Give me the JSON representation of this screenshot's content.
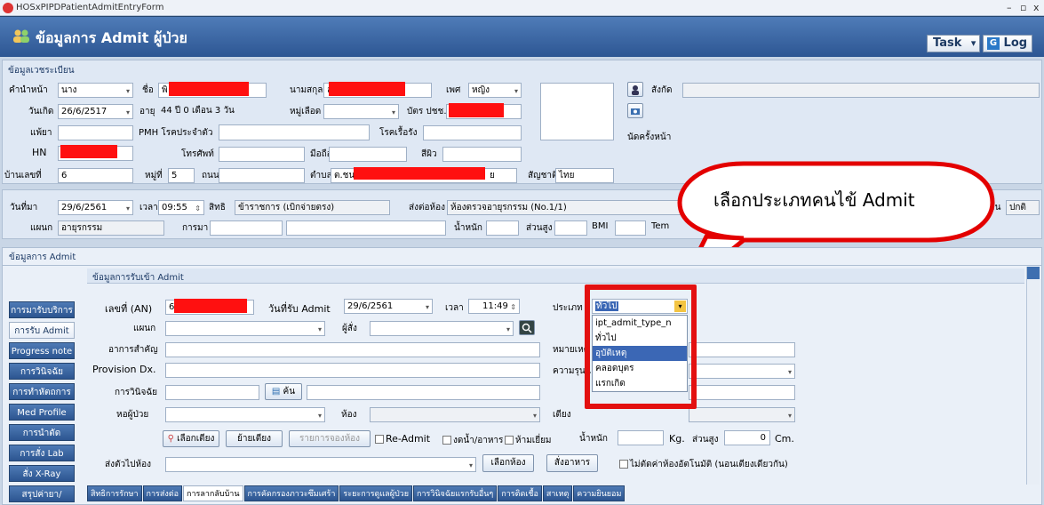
{
  "window": {
    "title": "HOSxPIPDPatientAdmitEntryForm",
    "min": "–",
    "max": "▫",
    "close": "x"
  },
  "header": {
    "title": "ข้อมูลการ Admit ผู้ป่วย",
    "task": "Task",
    "task_arrow": "▾",
    "log": "Log"
  },
  "registration": {
    "section": "ข้อมูลเวชระเบียน",
    "prefix_label": "คำนำหน้า",
    "prefix": "นาง",
    "name_label": "ชื่อ",
    "name": "พิ",
    "surname_label": "นามสกุล",
    "surname": "ล",
    "sex_label": "เพศ",
    "sex": "หญิง",
    "affiliation_label": "สังกัด",
    "dob_label": "วันเกิด",
    "dob": "26/6/2517",
    "age_label": "อายุ",
    "age": "44 ปี 0 เดือน 3 วัน",
    "blood_label": "หมู่เลือด",
    "cid_label": "บัตร ปชช.",
    "cid": "3",
    "allergy_label": "แพ้ยา",
    "pmh_label": "PMH โรคประจำตัว",
    "chronic_label": "โรคเรื้อรัง",
    "hn_label": "HN",
    "phone_label": "โทรศัพท์",
    "mobile_label": "มือถือ",
    "skin_label": "สีผิว",
    "prev_label": "นัดครั้งหน้า",
    "house_label": "บ้านเลขที่",
    "house": "6",
    "moo_label": "หมู่ที่",
    "moo": "5",
    "road_label": "ถนน",
    "tambon_label": "ตำบล",
    "tambon": "ต.ชน",
    "tambon_tail": "ย",
    "nation_label": "สัญชาติ",
    "nation": "ไทย"
  },
  "visit": {
    "date_label": "วันที่มา",
    "date": "29/6/2561",
    "time_label": "เวลา",
    "time": "09:55",
    "right_label": "สิทธิ",
    "right": "ข้าราชการ (เบิกจ่ายตรง)",
    "sendto_label": "ส่งต่อห้อง",
    "sendto": "ห้องตรวจอายุรกรรม (No.1/1)",
    "status_tail": "าน",
    "status": "ปกติ",
    "dept_label": "แผนก",
    "dept": "อายุรกรรม",
    "come_label": "การมา",
    "weight_label": "น้ำหนัก",
    "height_label": "ส่วนสูง",
    "bmi_label": "BMI",
    "temp_label": "Tem"
  },
  "callout": {
    "text": "เลือกประเภทคนไข้ Admit"
  },
  "admit": {
    "section": "ข้อมูลการ Admit",
    "subsection": "ข้อมูลการรับเข้า Admit",
    "an_label": "เลขที่ (AN)",
    "an": "6",
    "admit_date_label": "วันที่รับ Admit",
    "admit_date": "29/6/2561",
    "time_label": "เวลา",
    "time": "11:49",
    "type_label": "ประเภท",
    "type_value": "ทั่วไป",
    "type_options": [
      "ipt_admit_type_n",
      "ทั่วไป",
      "อุบัติเหตุ",
      "คลอดบุตร",
      "แรกเกิด"
    ],
    "ward_label": "แผนก",
    "orderer_label": "ผู้สั่ง",
    "symptom_label": "อาการสำคัญ",
    "note_label": "หมายเหต",
    "provdx_label": "Provision Dx.",
    "severity_label": "ความรุนแ",
    "dx_label": "การวินิจฉัย",
    "search_btn": "ค้น",
    "wardroom_label": "หอผู้ป่วย",
    "room_label": "ห้อง",
    "bed_label": "เตียง",
    "choose_bed": "เลือกเตียง",
    "move_bed": "ย้ายเตียง",
    "reserve_list": "รายการจองห้อง",
    "readmit": "Re-Admit",
    "npo": "งดน้ำ/อาหาร",
    "novisit": "ห้ามเยี่ยม",
    "weight_label": "น้ำหนัก",
    "kg": "Kg.",
    "height_label": "ส่วนสูง",
    "height": "0",
    "cm": "Cm.",
    "sendto_label": "ส่งตัวไปห้อง",
    "choose_room": "เลือกห้อง",
    "order_food": "สั่งอาหาร",
    "auto_room": "ไม่ตัดค่าห้องอัตโนมัติ (นอนเตียงเดียวกัน)"
  },
  "nav": [
    "การมารับบริการ",
    "การรับ Admit",
    "Progress note",
    "การวินิจฉัย",
    "การทำหัตถการ",
    "Med Profile",
    "การนำตัด",
    "การสั่ง Lab",
    "สั่ง X-Ray",
    "สรุปค่ายา/บริการ"
  ],
  "tabs": [
    "สิทธิการรักษา",
    "การส่งต่อ",
    "การลากลับบ้าน",
    "การคัดกรองภาวะซึมเศร้า",
    "ระยะการดูแลผู้ป่วย",
    "การวินิจฉัยแรกรับอื่นๆ",
    "การติดเชื้อ",
    "สาเหตุ",
    "ความยินยอม"
  ]
}
